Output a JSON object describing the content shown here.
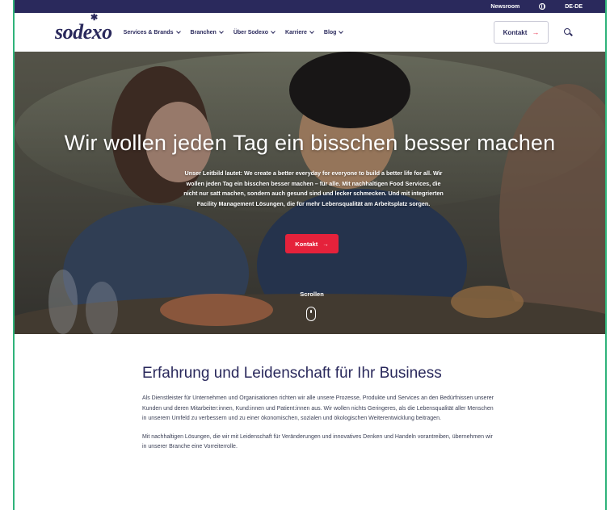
{
  "utility": {
    "newsroom": "Newsroom",
    "language": "DE-DE"
  },
  "header": {
    "logo": "sodexo",
    "nav": [
      {
        "label": "Services & Brands"
      },
      {
        "label": "Branchen"
      },
      {
        "label": "Über Sodexo"
      },
      {
        "label": "Karriere"
      },
      {
        "label": "Blog"
      }
    ],
    "contact_button": "Kontakt",
    "icons": {
      "search": "search-icon",
      "globe": "globe-icon",
      "arrow": "arrow-right-icon"
    }
  },
  "hero": {
    "title": "Wir wollen jeden Tag ein bisschen besser machen",
    "text": "Unser Leitbild lautet: We create a better everyday for everyone to build a better life for all. Wir wollen jeden Tag ein bisschen besser machen – für alle. Mit nachhaltigen Food Services, die nicht nur satt machen, sondern auch gesund sind und lecker schmecken. Und mit integrierten Facility Management Lösungen, die für mehr Lebensqualität am Arbeitsplatz sorgen.",
    "button": "Kontakt",
    "scroll": "Scrollen"
  },
  "intro": {
    "heading": "Erfahrung und Leidenschaft für Ihr Business",
    "paragraph1": "Als Dienstleister für Unternehmen und Organisationen richten wir alle unsere Prozesse, Produkte und Services an den Bedürfnissen unserer Kunden und deren Mitarbeiter:innen, Kund:innen und Patient:innen aus. Wir wollen nichts Geringeres, als die Lebensqualität aller Menschen in unserem Umfeld zu verbessern und zu einer ökonomischen, sozialen und ökologischen Weiterentwicklung beitragen.",
    "paragraph2": "Mit nachhaltigen Lösungen, die wir mit Leidenschaft für Veränderungen und innovatives Denken und Handeln vorantreiben, übernehmen wir in unserer Branche eine Vorreiterrolle."
  },
  "colors": {
    "brand_navy": "#2a295c",
    "accent_red": "#e5223b",
    "frame_green": "#2fb37a"
  }
}
